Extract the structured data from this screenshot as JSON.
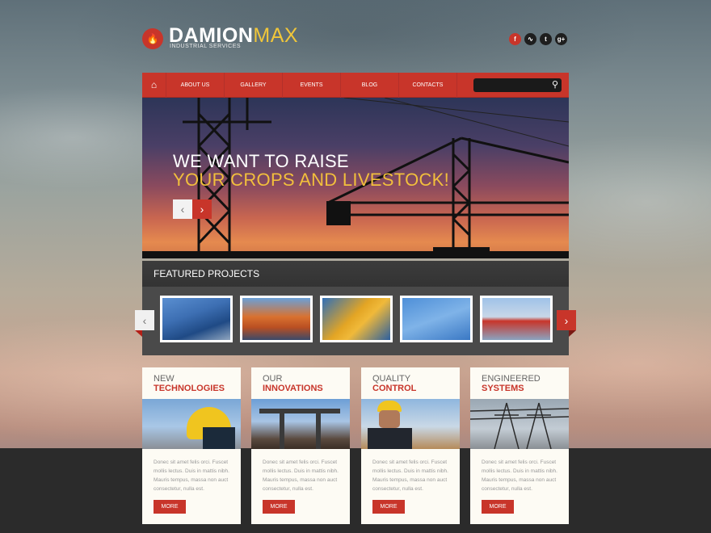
{
  "brand": {
    "name_main": "DAMION",
    "name_accent": "MAX",
    "tagline": "INDUSTRIAL SERVICES",
    "accent_color": "#c8352a",
    "secondary_color": "#f2bf3c"
  },
  "social": [
    "f",
    "rss",
    "t",
    "g+"
  ],
  "nav": {
    "items": [
      "About us",
      "Gallery",
      "Events",
      "Blog",
      "Contacts"
    ],
    "search_placeholder": ""
  },
  "hero": {
    "line1": "WE WANT TO RAISE",
    "line2": "YOUR CROPS AND LIVESTOCK!"
  },
  "featured": {
    "title": "FEATURED PROJECTS"
  },
  "cards": [
    {
      "title_top": "NEW",
      "title_bottom": "TECHNOLOGIES",
      "text": "Donec sit amet felis orci. Fuscet mollis lectus. Duis in mattis nibh. Mauris tempus, massa non auct consectetur, nulla est.",
      "button": "MORE"
    },
    {
      "title_top": "OUR",
      "title_bottom": "INNOVATIONS",
      "text": "Donec sit amet felis orci. Fuscet mollis lectus. Duis in mattis nibh. Mauris tempus, massa non auct consectetur, nulla est.",
      "button": "MORE"
    },
    {
      "title_top": "QUALITY",
      "title_bottom": "CONTROL",
      "text": "Donec sit amet felis orci. Fuscet mollis lectus. Duis in mattis nibh. Mauris tempus, massa non auct consectetur, nulla est.",
      "button": "MORE"
    },
    {
      "title_top": "ENGINEERED",
      "title_bottom": "SYSTEMS",
      "text": "Donec sit amet felis orci. Fuscet mollis lectus. Duis in mattis nibh. Mauris tempus, massa non auct consectetur, nulla est.",
      "button": "MORE"
    }
  ]
}
